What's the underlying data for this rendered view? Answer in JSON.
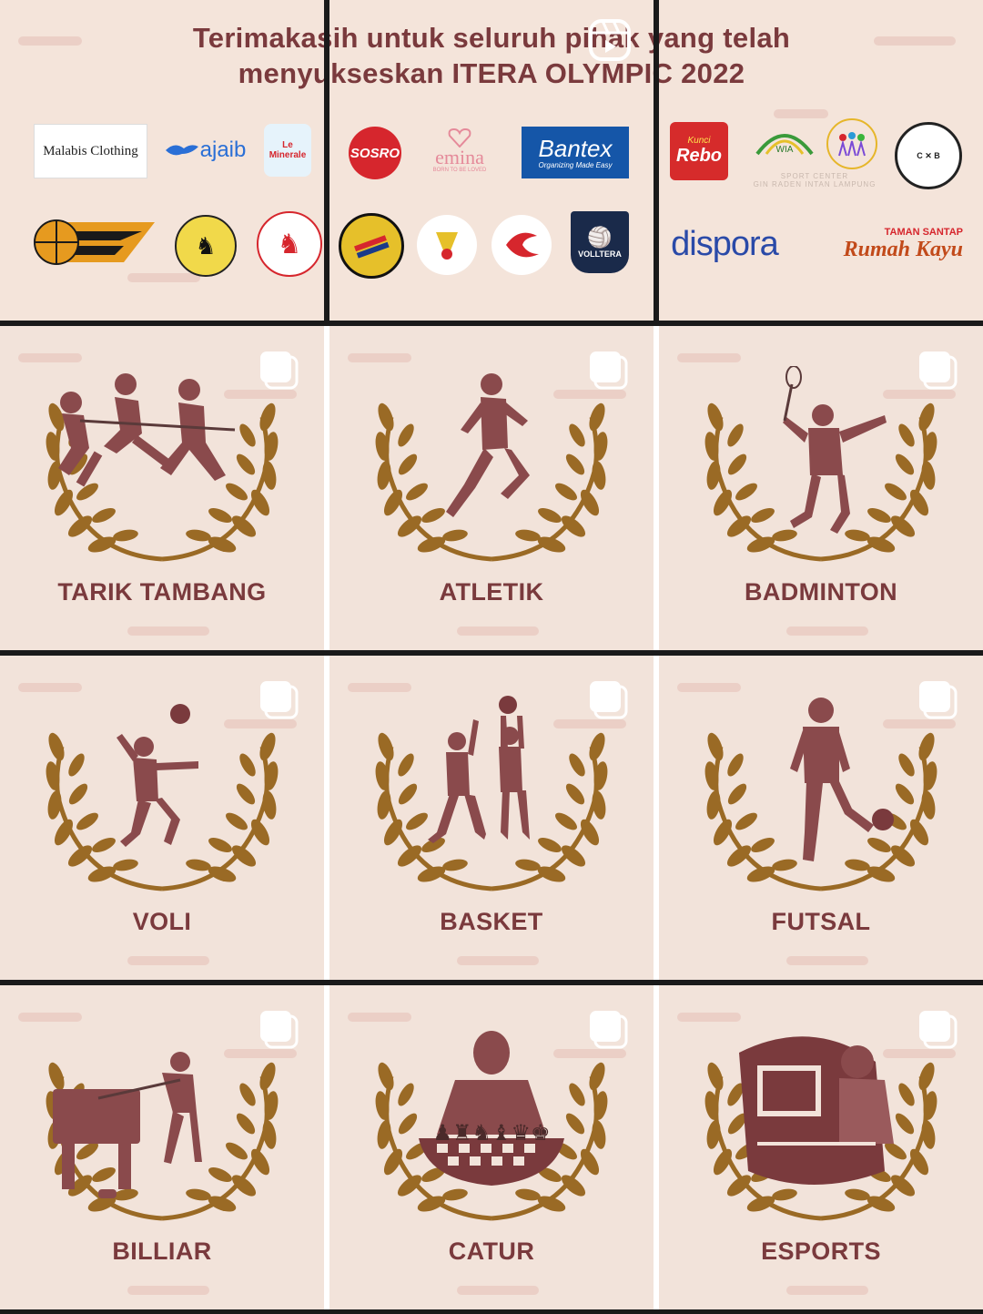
{
  "header": {
    "title_line1": "Terimakasih untuk seluruh pihak yang telah",
    "title_line2": "menyukseskan ITERA OLYMPIC 2022",
    "logos_row1": [
      "Malabis Clothing",
      "ajaib",
      "Le Minerale",
      "SOSRO",
      "emina",
      "Bantex",
      "Kunci Rebo",
      "WIA",
      "Sport Center Gin Raden Intan Lampung",
      "City Billiard & Cafe"
    ],
    "logos_row2": [
      "ITERA Basketball 2014",
      "ITERA Chess Club",
      "PERCASI LAMPUNG",
      "Persatuan Sepakbola ITERA",
      "badminton-logo",
      "Tera Esports",
      "VOLLTERA",
      "dispora",
      "Rumah Kayu"
    ],
    "logo_texts": {
      "malabis": "Malabis Clothing",
      "ajaib": "ajaib",
      "leminerale": "Le Minerale",
      "sosro": "SOSRO",
      "emina": "emina",
      "emina_tag": "BORN TO BE LOVED",
      "bantex": "Bantex",
      "bantex_tag": "Organizing Made Easy",
      "rebo": "Rebo",
      "rebo_small": "Kunci",
      "sport_center": "SPORT CENTER\nGIN RADEN INTAN LAMPUNG",
      "itera_basket": "ITERA",
      "dispora": "dispora",
      "rumah_kayu": "Rumah Kayu",
      "taman": "TAMAN SANTAP",
      "volltera": "VOLLTERA"
    }
  },
  "tiles": [
    {
      "label": "TARIK TAMBANG",
      "icon": "tug-of-war-icon"
    },
    {
      "label": "ATLETIK",
      "icon": "runner-icon"
    },
    {
      "label": "BADMINTON",
      "icon": "badminton-player-icon"
    },
    {
      "label": "VOLI",
      "icon": "volleyball-player-icon"
    },
    {
      "label": "BASKET",
      "icon": "basketball-players-icon"
    },
    {
      "label": "FUTSAL",
      "icon": "futsal-player-icon"
    },
    {
      "label": "BILLIAR",
      "icon": "billiards-player-icon"
    },
    {
      "label": "CATUR",
      "icon": "chess-player-icon"
    },
    {
      "label": "ESPORTS",
      "icon": "esports-gamer-icon"
    }
  ],
  "colors": {
    "background": "#f2e3da",
    "text_maroon": "#7a3a3d",
    "laurel_gold": "#9a6a25",
    "figure": "#8a4a4c",
    "grid_line": "#1a1a1a"
  }
}
